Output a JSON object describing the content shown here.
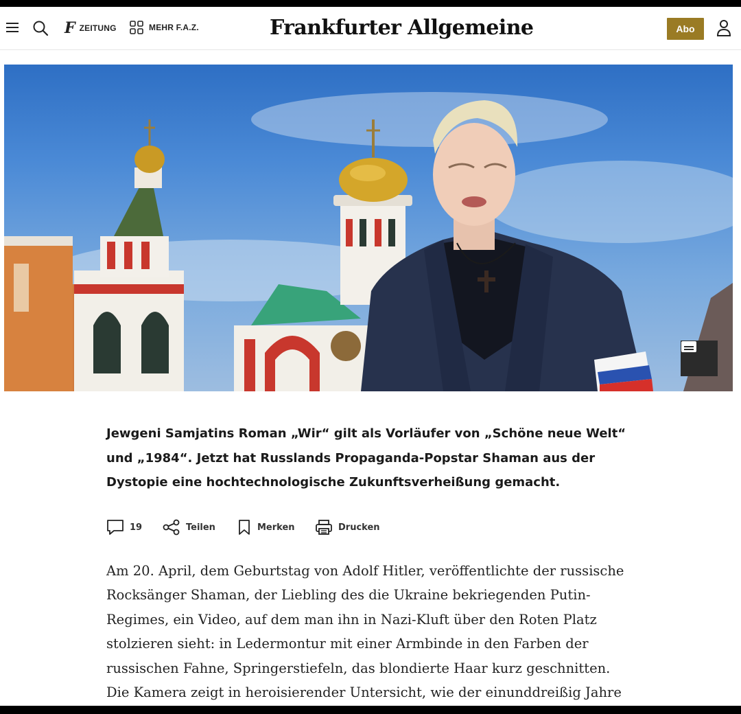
{
  "header": {
    "zeitung_label": "ZEITUNG",
    "mehr_label": "MEHR F.A.Z.",
    "logo_text": "Frankfurter Allgemeine",
    "abo_label": "Abo",
    "accent_color": "#9a7b24"
  },
  "hero": {
    "description_icon": "caption-icon"
  },
  "article": {
    "teaser": "Jewgeni Samjatins Roman „Wir“ gilt als Vorläufer von „Schöne neue Welt“ und „1984“. Jetzt hat Russlands Propaganda-Popstar Shaman aus der Dystopie eine hochtechnologische Zukunftsverheißung gemacht.",
    "actions": {
      "comments_count": "19",
      "share_label": "Teilen",
      "bookmark_label": "Merken",
      "print_label": "Drucken"
    },
    "body": "Am 20. April, dem Geburtstag von Adolf Hitler, veröffentlichte der russische Rocksänger Shaman, der Liebling des die Ukraine bekriegenden Putin-Regimes, ein Video, auf dem man ihn in Nazi-Kluft über den Roten Platz stolzieren sieht: in Ledermontur mit einer Armbinde in den Farben der russischen Fahne, Springerstiefeln, das blondierte Haar kurz geschnitten. Die Kamera zeigt in heroisierender Untersicht, wie der einunddreißig Jahre"
  }
}
